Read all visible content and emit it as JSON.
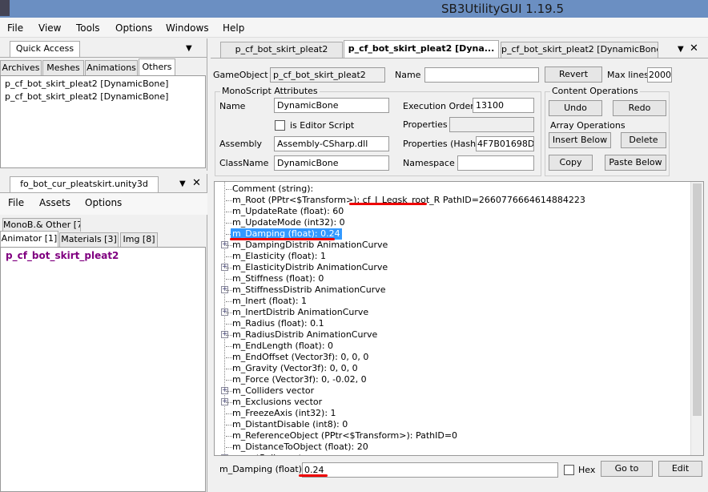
{
  "window": {
    "title": "SB3UtilityGUI 1.19.5"
  },
  "menu": [
    "File",
    "View",
    "Tools",
    "Options",
    "Windows",
    "Help"
  ],
  "quick_access": {
    "tab": "Quick Access",
    "subtabs": [
      "Archives",
      "Meshes",
      "Animations",
      "Others"
    ],
    "active_subtab": "Others",
    "items": [
      "p_cf_bot_skirt_pleat2 [DynamicBone]",
      "p_cf_bot_skirt_pleat2 [DynamicBone]"
    ]
  },
  "file_panel": {
    "tab": "fo_bot_cur_pleatskirt.unity3d",
    "menu": [
      "File",
      "Assets",
      "Options"
    ],
    "tabs_row1": [
      "MonoB.& Other [7]"
    ],
    "tabs_row2": [
      "Animator [1]",
      "Materials [3]",
      "Img [8]"
    ],
    "active_tab": "Animator [1]",
    "items": [
      "p_cf_bot_skirt_pleat2"
    ],
    "item_color": "#800080"
  },
  "editor_tabs": [
    "p_cf_bot_skirt_pleat2",
    "p_cf_bot_skirt_pleat2 [Dyna...",
    "p_cf_bot_skirt_pleat2 [DynamicBone]"
  ],
  "active_editor_tab": 1,
  "form": {
    "gameobject_label": "GameObject",
    "gameobject_value": "p_cf_bot_skirt_pleat2",
    "name_label": "Name",
    "name_value": "",
    "revert": "Revert",
    "maxlines_label": "Max lines",
    "maxlines_value": "2000",
    "mono_group": "MonoScript Attributes",
    "ms_name_label": "Name",
    "ms_name_value": "DynamicBone",
    "editor_script_label": "is Editor Script",
    "editor_script_checked": false,
    "assembly_label": "Assembly",
    "assembly_value": "Assembly-CSharp.dll",
    "classname_label": "ClassName",
    "classname_value": "DynamicBone",
    "exec_order_label": "Execution Order",
    "exec_order_value": "13100",
    "properties_label": "Properties",
    "properties_value": "",
    "hash_label": "Properties (Hash)",
    "hash_value": "4F7B01698D",
    "namespace_label": "Namespace",
    "namespace_value": "",
    "content_ops": "Content Operations",
    "undo": "Undo",
    "redo": "Redo",
    "array_ops": "Array Operations",
    "insert_below": "Insert Below",
    "delete": "Delete",
    "copy": "Copy",
    "paste_below": "Paste Below"
  },
  "tree": [
    {
      "text": "Comment (string):",
      "expandable": false
    },
    {
      "text": "m_Root (PPtr<$Transform>): cf_J_Legsk_root_R PathID=2660776664614884223",
      "expandable": false
    },
    {
      "text": "m_UpdateRate (float): 60",
      "expandable": false
    },
    {
      "text": "m_UpdateMode (int32): 0",
      "expandable": false
    },
    {
      "text": "m_Damping (float): 0.24",
      "expandable": false,
      "selected": true
    },
    {
      "text": "m_DampingDistrib AnimationCurve",
      "expandable": true
    },
    {
      "text": "m_Elasticity (float): 1",
      "expandable": false
    },
    {
      "text": "m_ElasticityDistrib AnimationCurve",
      "expandable": true
    },
    {
      "text": "m_Stiffness (float): 0",
      "expandable": false
    },
    {
      "text": "m_StiffnessDistrib AnimationCurve",
      "expandable": true
    },
    {
      "text": "m_Inert (float): 1",
      "expandable": false
    },
    {
      "text": "m_InertDistrib AnimationCurve",
      "expandable": true
    },
    {
      "text": "m_Radius (float): 0.1",
      "expandable": false
    },
    {
      "text": "m_RadiusDistrib AnimationCurve",
      "expandable": true
    },
    {
      "text": "m_EndLength (float): 0",
      "expandable": false
    },
    {
      "text": "m_EndOffset (Vector3f): 0, 0, 0",
      "expandable": false
    },
    {
      "text": "m_Gravity (Vector3f): 0, 0, 0",
      "expandable": false
    },
    {
      "text": "m_Force (Vector3f): 0, -0.02, 0",
      "expandable": false
    },
    {
      "text": "m_Colliders vector",
      "expandable": true
    },
    {
      "text": "m_Exclusions vector",
      "expandable": true
    },
    {
      "text": "m_FreezeAxis (int32): 1",
      "expandable": false
    },
    {
      "text": "m_DistantDisable (int8): 0",
      "expandable": false
    },
    {
      "text": "m_ReferenceObject (PPtr<$Transform>):  PathID=0",
      "expandable": false
    },
    {
      "text": "m_DistanceToObject (float): 20",
      "expandable": false
    },
    {
      "text": "m_notRolls vector",
      "expandable": true
    }
  ],
  "edit_bar": {
    "label": "m_Damping (float)",
    "value": "0.24",
    "hex_label": "Hex",
    "hex_checked": false,
    "goto": "Go to",
    "edit": "Edit"
  },
  "annotation_color": "#e00000"
}
